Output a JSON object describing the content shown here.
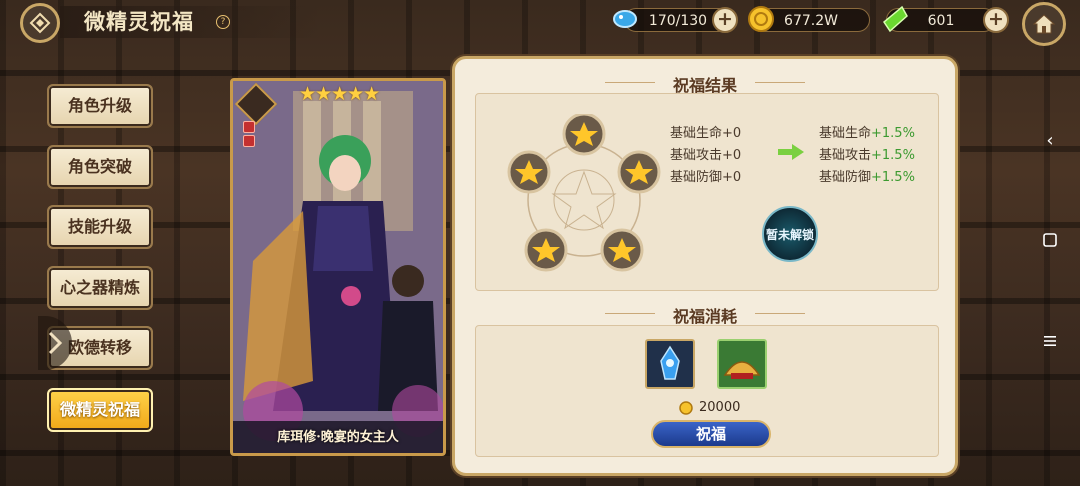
{
  "header": {
    "title": "微精灵祝福",
    "help": "?"
  },
  "resources": {
    "energy": "170/130",
    "gold": "677.2W",
    "gems": "601"
  },
  "menu": {
    "items": [
      {
        "label": "角色升级"
      },
      {
        "label": "角色突破"
      },
      {
        "label": "技能升级"
      },
      {
        "label": "心之器精炼"
      },
      {
        "label": "欧德转移"
      },
      {
        "label": "微精灵祝福",
        "active": true
      }
    ]
  },
  "card": {
    "name": "库珥修·晚宴的女主人",
    "stars": "★★★★★"
  },
  "result": {
    "title": "祝福结果",
    "current": [
      {
        "label": "基础生命",
        "value": "+0"
      },
      {
        "label": "基础攻击",
        "value": "+0"
      },
      {
        "label": "基础防御",
        "value": "+0"
      }
    ],
    "next": [
      {
        "label": "基础生命",
        "value": "+1.5%"
      },
      {
        "label": "基础攻击",
        "value": "+1.5%"
      },
      {
        "label": "基础防御",
        "value": "+1.5%"
      }
    ],
    "locked_label": "暂未解锁"
  },
  "cost": {
    "title": "祝福消耗",
    "items": [
      {
        "icon": "crystal-creature-icon"
      },
      {
        "icon": "gold-pile-icon"
      }
    ],
    "coin_amount": "20000",
    "button": "祝福"
  },
  "colors": {
    "accent_gold": "#c9a766",
    "positive": "#3c9a30",
    "active_button": "#f1a818"
  }
}
